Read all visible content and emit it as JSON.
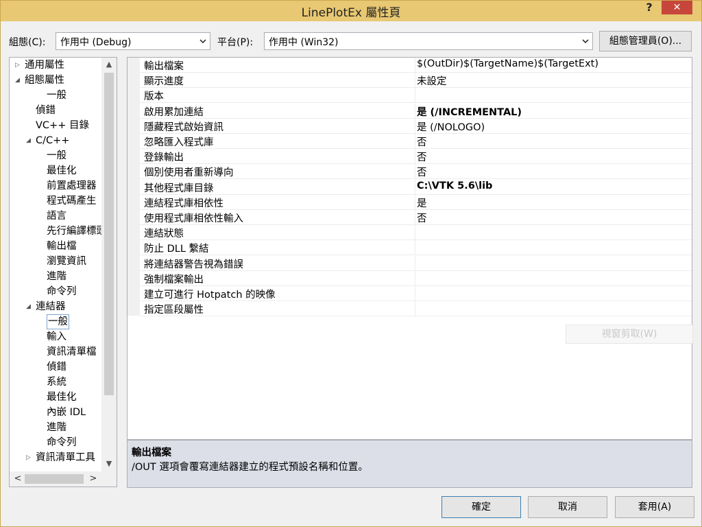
{
  "window": {
    "title": "LinePlotEx 屬性頁",
    "help": "?",
    "close": "✕"
  },
  "config": {
    "label": "組態(C):",
    "value": "作用中 (Debug)"
  },
  "platform": {
    "label": "平台(P):",
    "value": "作用中 (Win32)"
  },
  "config_manager_label": "組態管理員(O)...",
  "tree": {
    "items": [
      {
        "label": "通用屬性",
        "expander": "▷"
      },
      {
        "label": "組態屬性",
        "expander": "◢"
      },
      {
        "label": "一般"
      },
      {
        "label": "偵錯"
      },
      {
        "label": "VC++ 目錄"
      },
      {
        "label": "C/C++",
        "expander": "◢"
      },
      {
        "label": "一般"
      },
      {
        "label": "最佳化"
      },
      {
        "label": "前置處理器"
      },
      {
        "label": "程式碼產生"
      },
      {
        "label": "語言"
      },
      {
        "label": "先行編譯標頭"
      },
      {
        "label": "輸出檔"
      },
      {
        "label": "瀏覽資訊"
      },
      {
        "label": "進階"
      },
      {
        "label": "命令列"
      },
      {
        "label": "連結器",
        "expander": "◢"
      },
      {
        "label": "一般"
      },
      {
        "label": "輸入"
      },
      {
        "label": "資訊清單檔"
      },
      {
        "label": "偵錯"
      },
      {
        "label": "系統"
      },
      {
        "label": "最佳化"
      },
      {
        "label": "內嵌 IDL"
      },
      {
        "label": "進階"
      },
      {
        "label": "命令列"
      },
      {
        "label": "資訊清單工具",
        "expander": "▷"
      }
    ]
  },
  "properties": [
    {
      "name": "輸出檔案",
      "value": "$(OutDir)$(TargetName)$(TargetExt)",
      "bold": false
    },
    {
      "name": "顯示進度",
      "value": "未設定",
      "bold": false
    },
    {
      "name": "版本",
      "value": "",
      "bold": false
    },
    {
      "name": "啟用累加連結",
      "value": "是 (/INCREMENTAL)",
      "bold": true
    },
    {
      "name": "隱藏程式啟始資訊",
      "value": "是 (/NOLOGO)",
      "bold": false
    },
    {
      "name": "忽略匯入程式庫",
      "value": "否",
      "bold": false
    },
    {
      "name": "登錄輸出",
      "value": "否",
      "bold": false
    },
    {
      "name": "個別使用者重新導向",
      "value": "否",
      "bold": false
    },
    {
      "name": "其他程式庫目錄",
      "value": "C:\\VTK 5.6\\lib",
      "bold": true
    },
    {
      "name": "連結程式庫相依性",
      "value": "是",
      "bold": false
    },
    {
      "name": "使用程式庫相依性輸入",
      "value": "否",
      "bold": false
    },
    {
      "name": "連結狀態",
      "value": "",
      "bold": false
    },
    {
      "name": "防止 DLL 繫結",
      "value": "",
      "bold": false
    },
    {
      "name": "將連結器警告視為錯誤",
      "value": "",
      "bold": false
    },
    {
      "name": "強制檔案輸出",
      "value": "",
      "bold": false
    },
    {
      "name": "建立可進行 Hotpatch 的映像",
      "value": "",
      "bold": false
    },
    {
      "name": "指定區段屬性",
      "value": "",
      "bold": false
    }
  ],
  "ghost_button": "視窗剪取(W)",
  "description": {
    "title": "輸出檔案",
    "body": "/OUT 選項會覆寫連結器建立的程式預設名稱和位置。"
  },
  "buttons": {
    "ok": "確定",
    "cancel": "取消",
    "apply": "套用(A)"
  },
  "colors": {
    "titlebar": "#e8c872",
    "close": "#c7463b",
    "selection_border": "#7da2ce",
    "description_bg": "#dcdfe8"
  }
}
